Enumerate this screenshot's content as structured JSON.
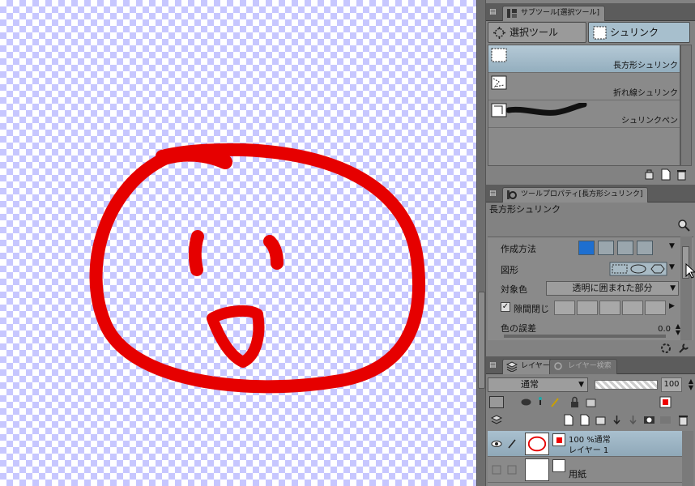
{
  "subtool_panel": {
    "tab_label": "サブツール[選択ツール]",
    "groups": [
      {
        "label": "選択ツール",
        "icon": "selection-tool-icon"
      },
      {
        "label": "シュリンク",
        "icon": "shrink-tool-icon",
        "active": true
      }
    ],
    "items": [
      {
        "label": "長方形シュリンク",
        "icon": "rect-shrink-icon",
        "selected": true
      },
      {
        "label": "折れ線シュリンク",
        "icon": "polyline-shrink-icon"
      },
      {
        "label": "シュリンクペン",
        "icon": "shrink-pen-icon"
      }
    ]
  },
  "tool_property": {
    "tab_label": "ツールプロパティ[長方形シュリンク]",
    "title": "長方形シュリンク",
    "rows": {
      "creation_method": "作成方法",
      "shape": "図形",
      "target_color_label": "対象色",
      "target_color_value": "透明に囲まれた部分",
      "gap_close": "隙間閉じ",
      "color_tolerance": "色の誤差",
      "color_tolerance_value": "0.0"
    }
  },
  "layer_panel": {
    "tab_label": "レイヤー",
    "tab2_label": "レイヤー検索",
    "blend_mode": "通常",
    "opacity": "100",
    "layers": [
      {
        "line1": "100 %通常",
        "line2": "レイヤー 1",
        "selected": true
      },
      {
        "name": "用紙"
      }
    ]
  },
  "colors": {
    "accent_selected": "#a7bfcd",
    "stroke": "#e60000",
    "checker": "#c7c7ff"
  }
}
